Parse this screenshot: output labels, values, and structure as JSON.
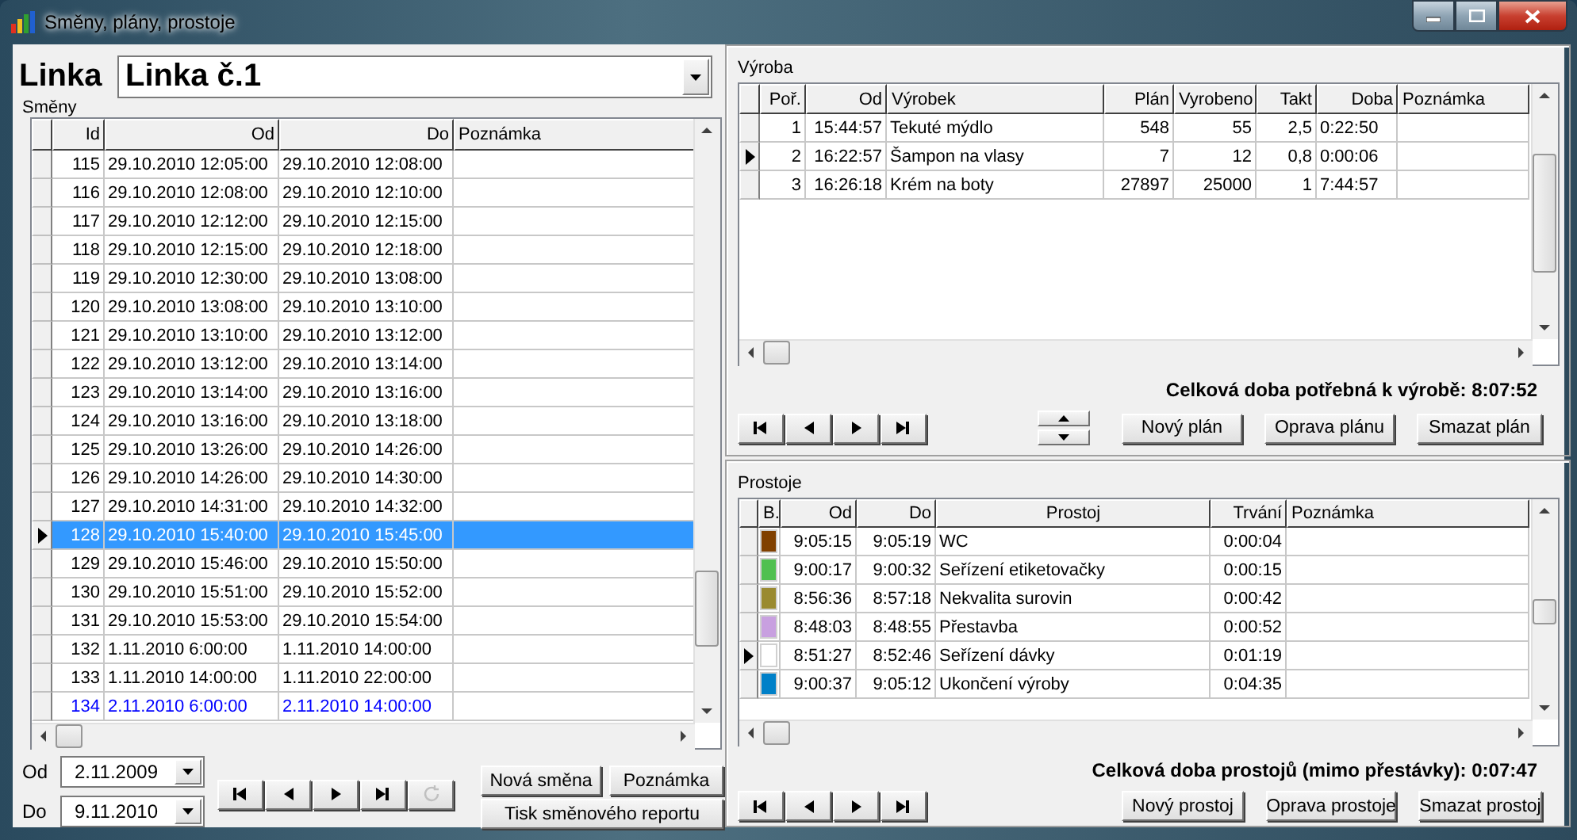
{
  "window": {
    "title": "Směny, plány, prostoje"
  },
  "line": {
    "label": "Linka",
    "value": "Linka č.1"
  },
  "shifts": {
    "label": "Směny",
    "columns": [
      "Id",
      "Od",
      "Do",
      "Poznámka"
    ],
    "rows": [
      {
        "cells": [
          "115",
          "29.10.2010 12:05:00",
          "29.10.2010 12:08:00",
          ""
        ],
        "selected": false,
        "current": false
      },
      {
        "cells": [
          "116",
          "29.10.2010 12:08:00",
          "29.10.2010 12:10:00",
          ""
        ],
        "selected": false,
        "current": false
      },
      {
        "cells": [
          "117",
          "29.10.2010 12:12:00",
          "29.10.2010 12:15:00",
          ""
        ],
        "selected": false,
        "current": false
      },
      {
        "cells": [
          "118",
          "29.10.2010 12:15:00",
          "29.10.2010 12:18:00",
          ""
        ],
        "selected": false,
        "current": false
      },
      {
        "cells": [
          "119",
          "29.10.2010 12:30:00",
          "29.10.2010 13:08:00",
          ""
        ],
        "selected": false,
        "current": false
      },
      {
        "cells": [
          "120",
          "29.10.2010 13:08:00",
          "29.10.2010 13:10:00",
          ""
        ],
        "selected": false,
        "current": false
      },
      {
        "cells": [
          "121",
          "29.10.2010 13:10:00",
          "29.10.2010 13:12:00",
          ""
        ],
        "selected": false,
        "current": false
      },
      {
        "cells": [
          "122",
          "29.10.2010 13:12:00",
          "29.10.2010 13:14:00",
          ""
        ],
        "selected": false,
        "current": false
      },
      {
        "cells": [
          "123",
          "29.10.2010 13:14:00",
          "29.10.2010 13:16:00",
          ""
        ],
        "selected": false,
        "current": false
      },
      {
        "cells": [
          "124",
          "29.10.2010 13:16:00",
          "29.10.2010 13:18:00",
          ""
        ],
        "selected": false,
        "current": false
      },
      {
        "cells": [
          "125",
          "29.10.2010 13:26:00",
          "29.10.2010 14:26:00",
          ""
        ],
        "selected": false,
        "current": false
      },
      {
        "cells": [
          "126",
          "29.10.2010 14:26:00",
          "29.10.2010 14:30:00",
          ""
        ],
        "selected": false,
        "current": false
      },
      {
        "cells": [
          "127",
          "29.10.2010 14:31:00",
          "29.10.2010 14:32:00",
          ""
        ],
        "selected": false,
        "current": false
      },
      {
        "cells": [
          "128",
          "29.10.2010 15:40:00",
          "29.10.2010 15:45:00",
          ""
        ],
        "selected": true,
        "current": false
      },
      {
        "cells": [
          "129",
          "29.10.2010 15:46:00",
          "29.10.2010 15:50:00",
          ""
        ],
        "selected": false,
        "current": false
      },
      {
        "cells": [
          "130",
          "29.10.2010 15:51:00",
          "29.10.2010 15:52:00",
          ""
        ],
        "selected": false,
        "current": false
      },
      {
        "cells": [
          "131",
          "29.10.2010 15:53:00",
          "29.10.2010 15:54:00",
          ""
        ],
        "selected": false,
        "current": false
      },
      {
        "cells": [
          "132",
          "1.11.2010 6:00:00",
          "1.11.2010 14:00:00",
          ""
        ],
        "selected": false,
        "current": false
      },
      {
        "cells": [
          "133",
          "1.11.2010 14:00:00",
          "1.11.2010 22:00:00",
          ""
        ],
        "selected": false,
        "current": false
      },
      {
        "cells": [
          "134",
          "2.11.2010 6:00:00",
          "2.11.2010 14:00:00",
          ""
        ],
        "selected": false,
        "current": true
      }
    ]
  },
  "filter": {
    "from_label": "Od",
    "from_value": "2.11.2009",
    "to_label": "Do",
    "to_value": "9.11.2010"
  },
  "navigator": {
    "refresh_disabled": true
  },
  "shift_buttons": [
    "Nová směna",
    "Poznámka",
    "Tisk směnového reportu"
  ],
  "production": {
    "label": "Výroba",
    "columns": [
      "Poř.",
      "Od",
      "Výrobek",
      "Plán",
      "Vyrobeno",
      "Takt",
      "Doba",
      "Poznámka"
    ],
    "rows": [
      {
        "cells": [
          "1",
          "15:44:57",
          "Tekuté mýdlo",
          "548",
          "55",
          "2,5",
          "0:22:50",
          ""
        ],
        "selected": false
      },
      {
        "cells": [
          "2",
          "16:22:57",
          "Šampon na vlasy",
          "7",
          "12",
          "0,8",
          "0:00:06",
          ""
        ],
        "selected": true
      },
      {
        "cells": [
          "3",
          "16:26:18",
          "Krém na boty",
          "27897",
          "25000",
          "1",
          "7:44:57",
          ""
        ],
        "selected": false
      }
    ],
    "total": "Celková doba potřebná k výrobě: 8:07:52",
    "buttons": [
      "Nový plán",
      "Oprava plánu",
      "Smazat plán"
    ]
  },
  "downtimes": {
    "label": "Prostoje",
    "columns": [
      "B.",
      "Od",
      "Do",
      "Prostoj",
      "Trvání",
      "Poznámka"
    ],
    "rows": [
      {
        "color": "#804000",
        "cells": [
          "",
          "9:05:15",
          "9:05:19",
          "WC",
          "0:00:04",
          ""
        ],
        "selected": false
      },
      {
        "color": "#50c050",
        "cells": [
          "",
          "9:00:17",
          "9:00:32",
          "Seřízení etiketovačky",
          "0:00:15",
          ""
        ],
        "selected": false
      },
      {
        "color": "#9a8a30",
        "cells": [
          "",
          "8:56:36",
          "8:57:18",
          "Nekvalita surovin",
          "0:00:42",
          ""
        ],
        "selected": false
      },
      {
        "color": "#c8a0e0",
        "cells": [
          "",
          "8:48:03",
          "8:48:55",
          "Přestavba",
          "0:00:52",
          ""
        ],
        "selected": false
      },
      {
        "color": "#ffffff",
        "cells": [
          "",
          "8:51:27",
          "8:52:46",
          "Seřízení dávky",
          "0:01:19",
          ""
        ],
        "selected": true
      },
      {
        "color": "#0080c8",
        "cells": [
          "",
          "9:00:37",
          "9:05:12",
          "Ukončení výroby",
          "0:04:35",
          ""
        ],
        "selected": false
      }
    ],
    "total": "Celková doba prostojů (mimo přestávky): 0:07:47",
    "buttons": [
      "Nový prostoj",
      "Oprava prostoje",
      "Smazat prostoj"
    ]
  }
}
